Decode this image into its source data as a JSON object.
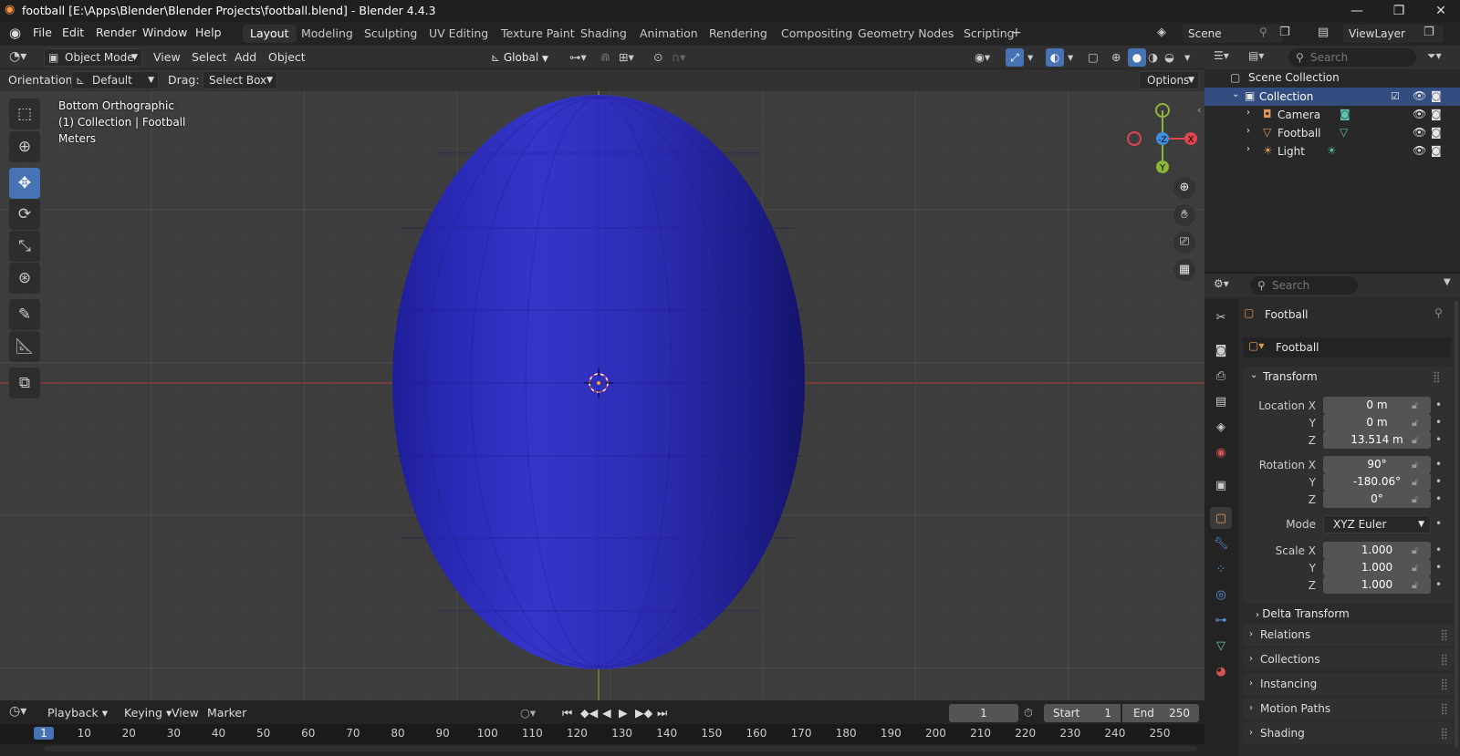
{
  "window": {
    "title": "football [E:\\Apps\\Blender\\Blender Projects\\football.blend] - Blender 4.4.3"
  },
  "menu": [
    "File",
    "Edit",
    "Render",
    "Window",
    "Help"
  ],
  "workspaces": [
    "Layout",
    "Modeling",
    "Sculpting",
    "UV Editing",
    "Texture Paint",
    "Shading",
    "Animation",
    "Rendering",
    "Compositing",
    "Geometry Nodes",
    "Scripting"
  ],
  "active_workspace": "Layout",
  "scene": {
    "name": "Scene",
    "view_layer": "ViewLayer"
  },
  "viewport": {
    "mode": "Object Mode",
    "menu": [
      "View",
      "Select",
      "Add",
      "Object"
    ],
    "transform_orientation": "Global",
    "orientation_label": "Orientation:",
    "orientation_value": "Default",
    "drag_label": "Drag:",
    "drag_value": "Select Box",
    "options_label": "Options",
    "overlay": {
      "view_name": "Bottom Orthographic",
      "collection": "(1) Collection | Football",
      "units": "Meters"
    },
    "gizmo": {
      "x": "X",
      "y": "Y",
      "z": "-Z"
    },
    "object_color": "#2626b0"
  },
  "outliner": {
    "search_placeholder": "Search",
    "scene_collection": "Scene Collection",
    "collection": "Collection",
    "items": [
      "Camera",
      "Football",
      "Light"
    ]
  },
  "properties": {
    "search_placeholder": "Search",
    "object_name": "Football",
    "object_field": "Football",
    "transform_header": "Transform",
    "location_label": "Location X",
    "location": [
      "0 m",
      "0 m",
      "13.514 m"
    ],
    "rotation_label": "Rotation X",
    "rotation": [
      "90°",
      "-180.06°",
      "0°"
    ],
    "mode_label": "Mode",
    "mode_value": "XYZ Euler",
    "scale_label": "Scale X",
    "scale": [
      "1.000",
      "1.000",
      "1.000"
    ],
    "axis_y": "Y",
    "axis_z": "Z",
    "delta_transform": "Delta Transform",
    "panels": [
      "Relations",
      "Collections",
      "Instancing",
      "Motion Paths",
      "Shading"
    ]
  },
  "timeline": {
    "menu": [
      "Playback",
      "Keying",
      "View",
      "Marker"
    ],
    "current_frame": "1",
    "start_label": "Start",
    "start": "1",
    "end_label": "End",
    "end": "250",
    "ruler": [
      "1",
      "10",
      "20",
      "30",
      "40",
      "50",
      "60",
      "70",
      "80",
      "90",
      "100",
      "110",
      "120",
      "130",
      "140",
      "150",
      "160",
      "170",
      "180",
      "190",
      "200",
      "210",
      "220",
      "230",
      "240",
      "250"
    ]
  }
}
